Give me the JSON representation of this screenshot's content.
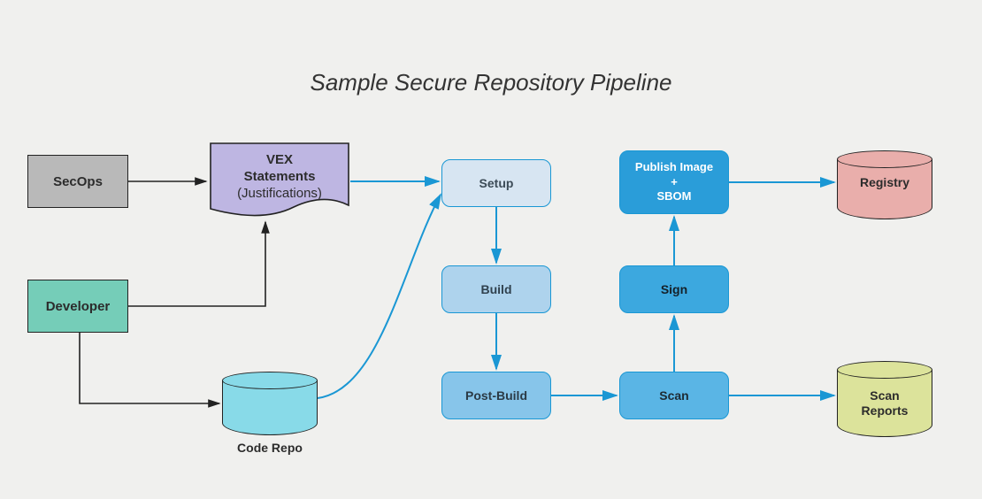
{
  "title": "Sample Secure Repository Pipeline",
  "nodes": {
    "secops": "SecOps",
    "developer": "Developer",
    "vex_line1": "VEX",
    "vex_line2": "Statements",
    "vex_line3": "(Justifications)",
    "code_repo": "Code Repo",
    "setup": "Setup",
    "build": "Build",
    "postbuild": "Post-Build",
    "scan": "Scan",
    "sign": "Sign",
    "publish_line1": "Publish Image",
    "publish_line2": "+",
    "publish_line3": "SBOM",
    "registry": "Registry",
    "scan_reports": "Scan\nReports"
  },
  "flows": [
    [
      "SecOps",
      "VEX Statements"
    ],
    [
      "Developer",
      "VEX Statements"
    ],
    [
      "Developer",
      "Code Repo"
    ],
    [
      "VEX Statements",
      "Setup"
    ],
    [
      "Code Repo",
      "Setup"
    ],
    [
      "Setup",
      "Build"
    ],
    [
      "Build",
      "Post-Build"
    ],
    [
      "Post-Build",
      "Scan"
    ],
    [
      "Scan",
      "Sign"
    ],
    [
      "Sign",
      "Publish Image + SBOM"
    ],
    [
      "Publish Image + SBOM",
      "Registry"
    ],
    [
      "Scan",
      "Scan Reports"
    ]
  ]
}
